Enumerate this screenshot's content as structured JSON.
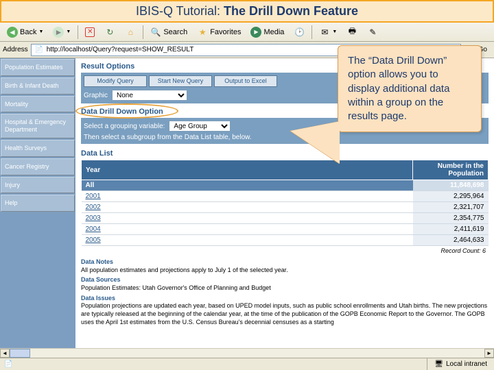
{
  "slide": {
    "prefix": "IBIS-Q Tutorial: ",
    "bold": "The Drill Down Feature"
  },
  "toolbar": {
    "back": "Back",
    "search": "Search",
    "favorites": "Favorites",
    "media": "Media"
  },
  "address": {
    "label": "Address",
    "url": "http://localhost/Query?request=SHOW_RESULT",
    "go": "Go"
  },
  "sidebar": {
    "items": [
      {
        "label": "Population Estimates"
      },
      {
        "label": "Birth & Infant Death"
      },
      {
        "label": "Mortality"
      },
      {
        "label": "Hospital & Emergency Department"
      },
      {
        "label": "Health Surveys"
      },
      {
        "label": "Cancer Registry"
      },
      {
        "label": "Injury"
      },
      {
        "label": "Help"
      }
    ]
  },
  "result_options": {
    "title": "Result Options",
    "buttons": [
      "Modify Query",
      "Start New Query",
      "Output to Excel"
    ],
    "graphic_label": "Graphic",
    "graphic_value": "None"
  },
  "drilldown": {
    "title": "Data Drill Down Option",
    "var_label": "Select a grouping variable:",
    "var_value": "Age Group",
    "hint": "Then select a subgroup from the Data List table, below."
  },
  "datalist": {
    "title": "Data List",
    "col_year": "Year",
    "col_num": "Number in the Population",
    "rows": [
      {
        "y": "All",
        "v": "11,848,698",
        "link": false
      },
      {
        "y": "2001",
        "v": "2,295,964",
        "link": true
      },
      {
        "y": "2002",
        "v": "2,321,707",
        "link": true
      },
      {
        "y": "2003",
        "v": "2,354,775",
        "link": true
      },
      {
        "y": "2004",
        "v": "2,411,619",
        "link": true
      },
      {
        "y": "2005",
        "v": "2,464,633",
        "link": true
      }
    ],
    "record_count": "Record Count:  6"
  },
  "notes": {
    "n1_h": "Data Notes",
    "n1_t": "All population estimates and projections apply to July 1 of the selected year.",
    "n2_h": "Data Sources",
    "n2_t": "Population Estimates: Utah Governor's Office of Planning and Budget",
    "n3_h": "Data Issues",
    "n3_t": "Population projections are updated each year, based on UPED model inputs, such as public school enrollments and Utah births. The new projections are typically released at the beginning of the calendar year, at the time of the publication of the GOPB Economic Report to the Governor. The GOPB uses the April 1st estimates from the U.S. Census Bureau's decennial censuses as a starting"
  },
  "callout": "The “Data Drill Down” option allows you to display additional data within a group on the results page.",
  "status": {
    "zone": "Local intranet"
  }
}
